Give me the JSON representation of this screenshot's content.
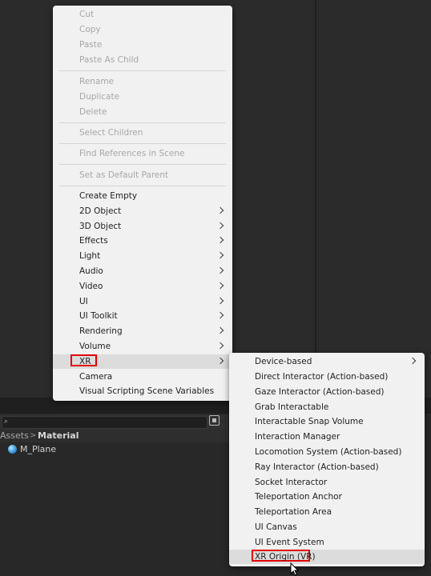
{
  "project": {
    "breadcrumb": [
      "Assets",
      "Material"
    ],
    "separator": ">",
    "assets": [
      {
        "name": "M_Plane",
        "icon": "material-sphere-icon"
      }
    ]
  },
  "context_menu": {
    "items": [
      {
        "label": "Cut",
        "disabled": true
      },
      {
        "label": "Copy",
        "disabled": true
      },
      {
        "label": "Paste",
        "disabled": true
      },
      {
        "label": "Paste As Child",
        "disabled": true
      },
      {
        "label": "Rename",
        "disabled": true
      },
      {
        "label": "Duplicate",
        "disabled": true
      },
      {
        "label": "Delete",
        "disabled": true
      },
      {
        "label": "Select Children",
        "disabled": true
      },
      {
        "label": "Find References in Scene",
        "disabled": true
      },
      {
        "label": "Set as Default Parent",
        "disabled": true
      },
      {
        "label": "Create Empty",
        "disabled": false
      },
      {
        "label": "2D Object",
        "submenu": true
      },
      {
        "label": "3D Object",
        "submenu": true
      },
      {
        "label": "Effects",
        "submenu": true
      },
      {
        "label": "Light",
        "submenu": true
      },
      {
        "label": "Audio",
        "submenu": true
      },
      {
        "label": "Video",
        "submenu": true
      },
      {
        "label": "UI",
        "submenu": true
      },
      {
        "label": "UI Toolkit",
        "submenu": true
      },
      {
        "label": "Rendering",
        "submenu": true
      },
      {
        "label": "Volume",
        "submenu": true
      },
      {
        "label": "XR",
        "submenu": true,
        "highlighted": true
      },
      {
        "label": "Camera",
        "disabled": false
      },
      {
        "label": "Visual Scripting Scene Variables",
        "disabled": false
      }
    ]
  },
  "xr_submenu": {
    "items": [
      {
        "label": "Device-based",
        "submenu": true
      },
      {
        "label": "Direct Interactor (Action-based)"
      },
      {
        "label": "Gaze Interactor (Action-based)"
      },
      {
        "label": "Grab Interactable"
      },
      {
        "label": "Interactable Snap Volume"
      },
      {
        "label": "Interaction Manager"
      },
      {
        "label": "Locomotion System (Action-based)"
      },
      {
        "label": "Ray Interactor (Action-based)"
      },
      {
        "label": "Socket Interactor"
      },
      {
        "label": "Teleportation Anchor"
      },
      {
        "label": "Teleportation Area"
      },
      {
        "label": "UI Canvas"
      },
      {
        "label": "UI Event System"
      },
      {
        "label": "XR Origin (VR)",
        "highlighted": true
      }
    ]
  },
  "colors": {
    "menu_bg": "#f1f1f1",
    "highlight_box": "#e00000",
    "disabled_text": "#a7a7a7",
    "editor_bg": "#2b2b2b"
  }
}
